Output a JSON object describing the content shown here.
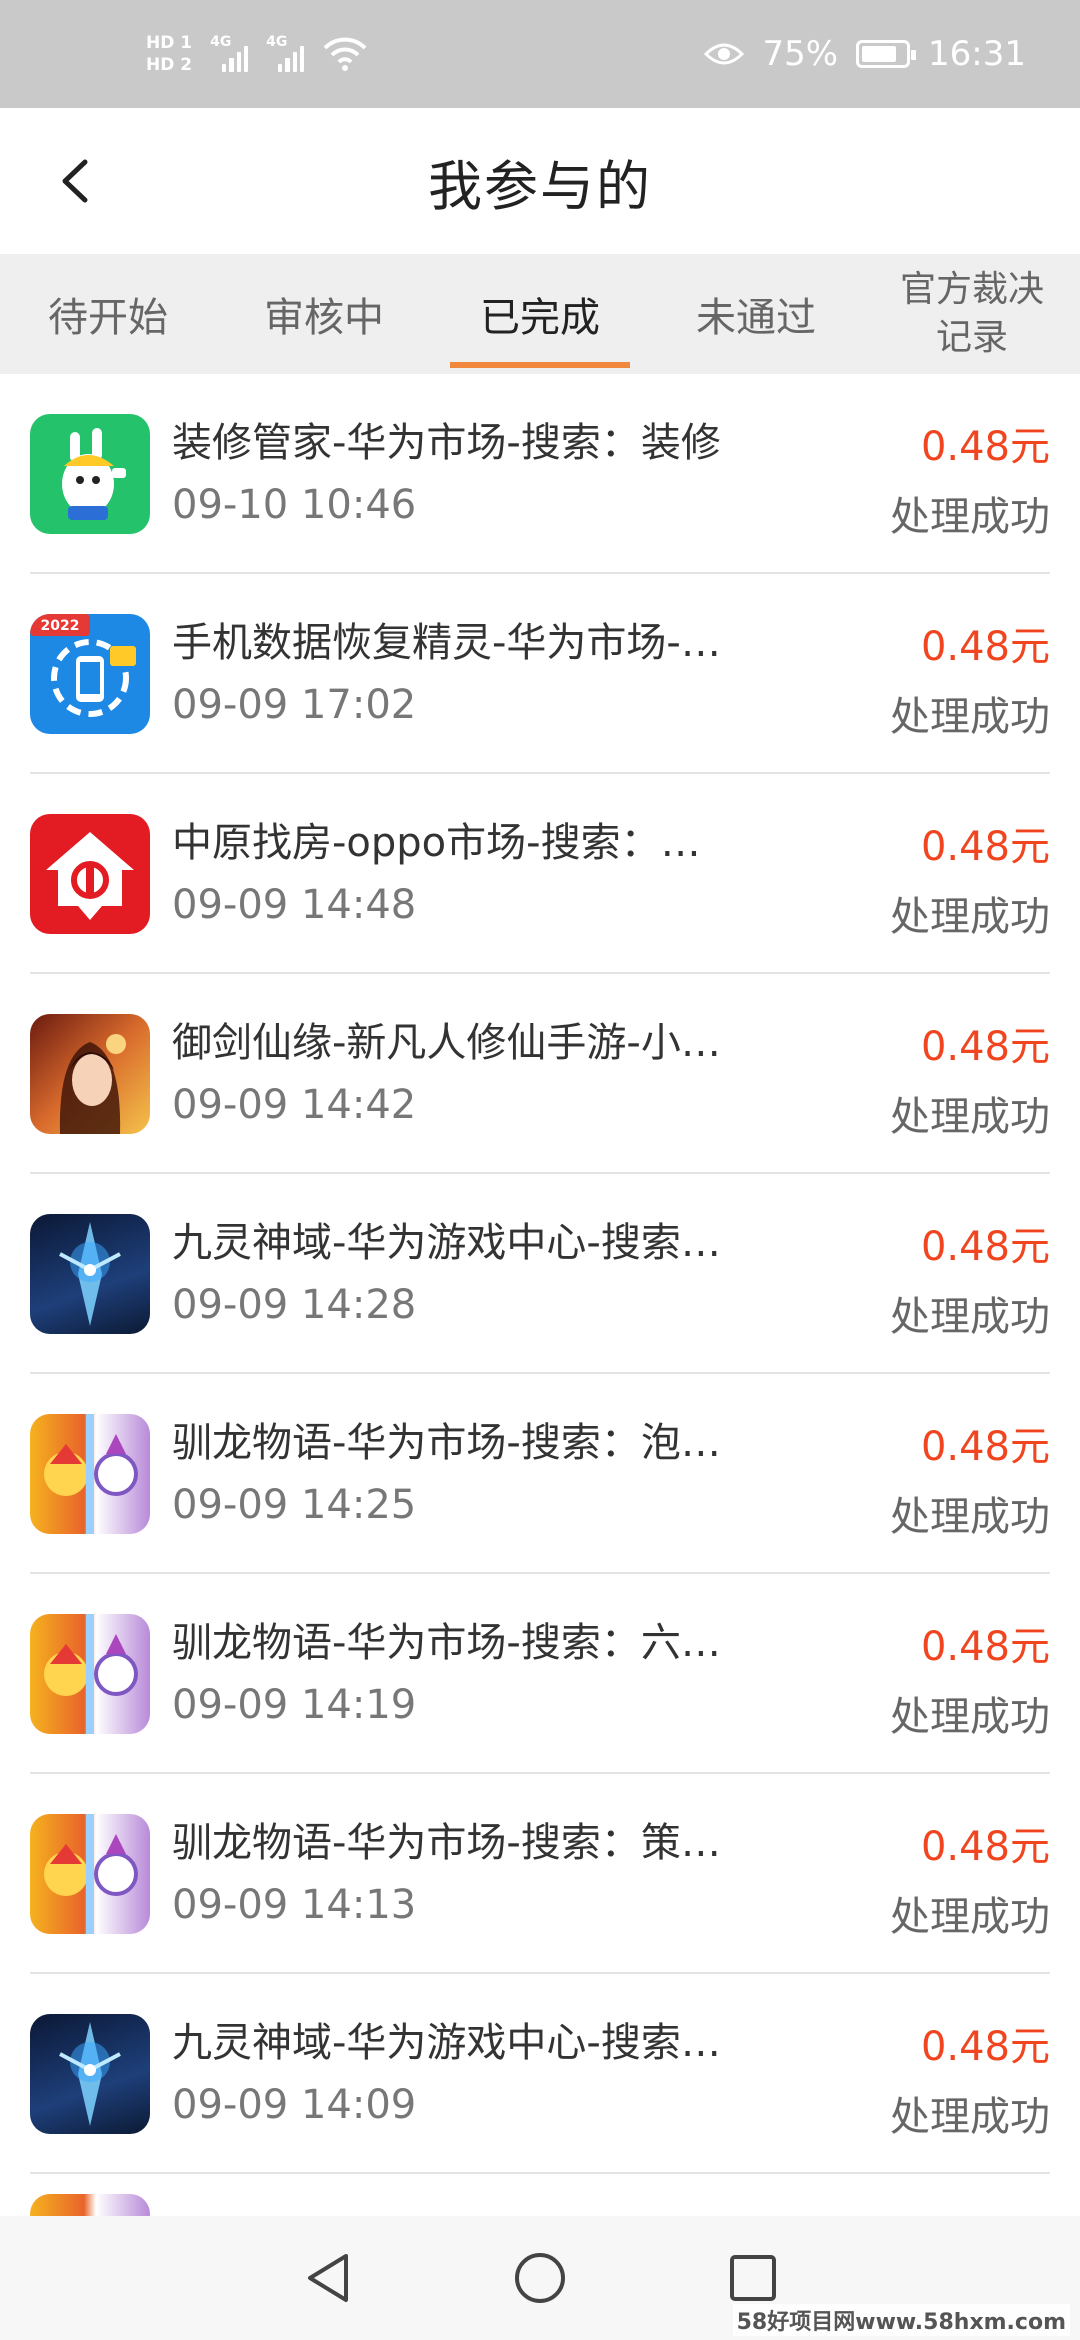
{
  "status_bar": {
    "hd1": "HD 1",
    "hd2": "HD 2",
    "net1": "4G",
    "net2": "4G",
    "battery": "75%",
    "time": "16:31"
  },
  "header": {
    "title": "我参与的"
  },
  "tabs": [
    {
      "label": "待开始"
    },
    {
      "label": "审核中"
    },
    {
      "label": "已完成"
    },
    {
      "label": "未通过"
    },
    {
      "label": "官方裁决记录"
    }
  ],
  "active_tab": "已完成",
  "items": [
    {
      "icon": "zhuangxiu-app-icon",
      "title": "装修管家-华为市场-搜索：装修",
      "time": "09-10 10:46",
      "amount": "0.48元",
      "status": "处理成功"
    },
    {
      "icon": "data-recovery-app-icon",
      "title": "手机数据恢复精灵-华为市场-…",
      "time": "09-09 17:02",
      "amount": "0.48元",
      "status": "处理成功"
    },
    {
      "icon": "house-app-icon",
      "title": "中原找房-oppo市场-搜索：…",
      "time": "09-09 14:48",
      "amount": "0.48元",
      "status": "处理成功"
    },
    {
      "icon": "yujian-game-icon",
      "title": "御剑仙缘-新凡人修仙手游-小…",
      "time": "09-09 14:42",
      "amount": "0.48元",
      "status": "处理成功"
    },
    {
      "icon": "jiuling-game-icon",
      "title": "九灵神域-华为游戏中心-搜索…",
      "time": "09-09 14:28",
      "amount": "0.48元",
      "status": "处理成功"
    },
    {
      "icon": "xunlong-game-icon",
      "title": "驯龙物语-华为市场-搜索：泡…",
      "time": "09-09 14:25",
      "amount": "0.48元",
      "status": "处理成功"
    },
    {
      "icon": "xunlong-game-icon",
      "title": "驯龙物语-华为市场-搜索：六…",
      "time": "09-09 14:19",
      "amount": "0.48元",
      "status": "处理成功"
    },
    {
      "icon": "xunlong-game-icon",
      "title": "驯龙物语-华为市场-搜索：策…",
      "time": "09-09 14:13",
      "amount": "0.48元",
      "status": "处理成功"
    },
    {
      "icon": "jiuling-game-icon",
      "title": "九灵神域-华为游戏中心-搜索…",
      "time": "09-09 14:09",
      "amount": "0.48元",
      "status": "处理成功"
    }
  ],
  "icon_badge": "2022",
  "watermark": "58好项目网www.58hxm.com",
  "colors": {
    "accent": "#f0883e",
    "amount": "#f0451e",
    "status_bar": "#c9c9c9",
    "tab_bg": "#efefef"
  }
}
